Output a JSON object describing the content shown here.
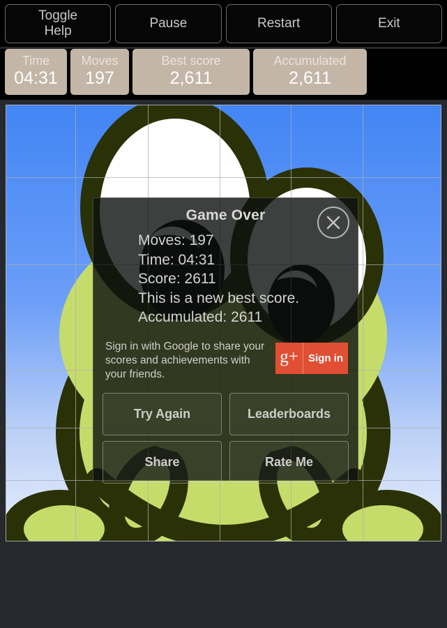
{
  "controls": [
    {
      "name": "toggle-help",
      "label": "Toggle\nHelp"
    },
    {
      "name": "pause",
      "label": "Pause"
    },
    {
      "name": "restart",
      "label": "Restart"
    },
    {
      "name": "exit",
      "label": "Exit"
    }
  ],
  "stats": [
    {
      "name": "time",
      "label": "Time",
      "value": "04:31"
    },
    {
      "name": "moves",
      "label": "Moves",
      "value": "197"
    },
    {
      "name": "best-score",
      "label": "Best score",
      "value": "2,611"
    },
    {
      "name": "accumulated",
      "label": "Accumulated",
      "value": "2,611"
    }
  ],
  "dialog": {
    "title": "Game Over",
    "close_icon": "close-icon",
    "lines": [
      "Moves: 197",
      "Time: 04:31",
      "Score: 2611",
      "This is a new best score.",
      "Accumulated: 2611"
    ],
    "signin_text": "Sign in with Google to share your scores and achievements with your friends.",
    "gplus": {
      "mark": "g+",
      "label": "Sign in"
    },
    "actions": [
      {
        "name": "try-again",
        "label": "Try Again"
      },
      {
        "name": "leaderboards",
        "label": "Leaderboards"
      },
      {
        "name": "share",
        "label": "Share"
      },
      {
        "name": "rate-me",
        "label": "Rate Me"
      }
    ]
  },
  "colors": {
    "stat_box": "#C3B6A7",
    "gplus_button": "#E04E33",
    "page_background": "#26292E",
    "bar_background": "#000000",
    "sky_top": "#4285F4",
    "sky_bottom": "#E6EEFB",
    "frog_body": "#C6DC6A",
    "frog_outline": "#2B3106"
  },
  "board": {
    "grid_columns": 5,
    "grid_rows": 5,
    "image": "frog-puzzle-image"
  }
}
